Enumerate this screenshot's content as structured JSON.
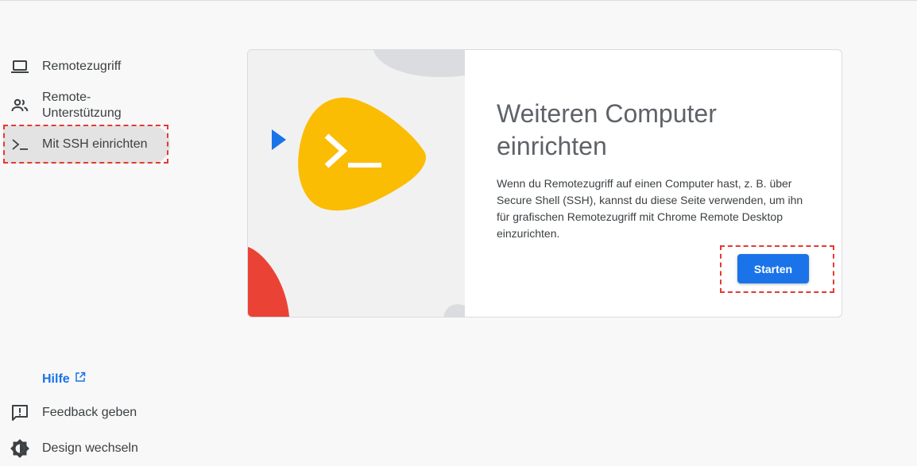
{
  "sidebar": {
    "items": [
      {
        "label": "Remotezugriff",
        "icon": "laptop-icon"
      },
      {
        "label": "Remote-\nUnterstützung",
        "icon": "people-icon"
      },
      {
        "label": "Mit SSH einrichten",
        "icon": "terminal-icon"
      }
    ],
    "help_label": "Hilfe",
    "feedback_label": "Feedback geben",
    "design_label": "Design wechseln"
  },
  "card": {
    "title": "Weiteren Computer einrichten",
    "body": "Wenn du Remotezugriff auf einen Computer hast, z. B. über Secure Shell (SSH), kannst du diese Seite verwenden, um ihn für grafischen Remotezugriff mit Chrome Remote Desktop einzurichten.",
    "button_label": "Starten"
  },
  "colors": {
    "accent": "#1a73e8",
    "illustration_yellow": "#fbbc04",
    "illustration_red": "#ea4335",
    "highlight_dash": "#e53935"
  }
}
